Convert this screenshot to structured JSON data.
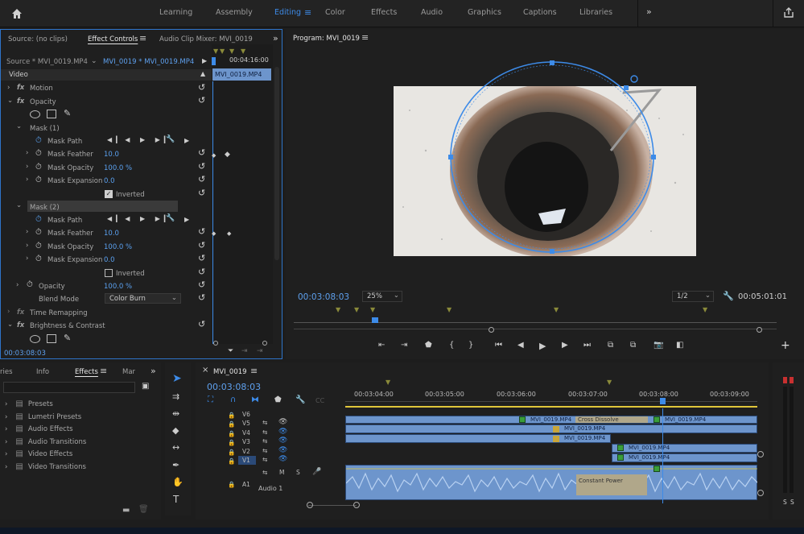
{
  "workspace": {
    "tabs": [
      "Learning",
      "Assembly",
      "Editing",
      "Color",
      "Effects",
      "Audio",
      "Graphics",
      "Captions",
      "Libraries"
    ],
    "active": "Editing",
    "more_icon": "chevron-double-right-icon"
  },
  "effect_panel": {
    "tabs": [
      "Source: (no clips)",
      "Effect Controls",
      "Audio Clip Mixer: MVI_0019"
    ],
    "source_label": "Source * MVI_0019.MP4",
    "clip_label": "MVI_0019 * MVI_0019.MP4",
    "timecode_ruler": "00:04:16:00",
    "clip_bar": "MVI_0019.MP4",
    "section": "Video",
    "motion": "Motion",
    "opacity": "Opacity",
    "mask1": {
      "name": "Mask (1)",
      "path": "Mask Path",
      "feather_label": "Mask Feather",
      "feather": "10.0",
      "opacity_label": "Mask Opacity",
      "opacity": "100.0 %",
      "expansion_label": "Mask Expansion",
      "expansion": "0.0",
      "inverted": "Inverted",
      "inverted_checked": true
    },
    "mask2": {
      "name": "Mask (2)",
      "path": "Mask Path",
      "feather_label": "Mask Feather",
      "feather": "10.0",
      "opacity_label": "Mask Opacity",
      "opacity": "100.0 %",
      "expansion_label": "Mask Expansion",
      "expansion": "0.0",
      "inverted": "Inverted",
      "inverted_checked": false
    },
    "opacity_label": "Opacity",
    "opacity_value": "100.0 %",
    "blend_label": "Blend Mode",
    "blend_value": "Color Burn",
    "time_remap": "Time Remapping",
    "brightness": "Brightness & Contrast",
    "timecode": "00:03:08:03"
  },
  "program": {
    "title": "Program: MVI_0019",
    "timecode": "00:03:08:03",
    "zoom": "25%",
    "resolution": "1/2",
    "duration": "00:05:01:01"
  },
  "effects_panel": {
    "tabs": [
      "ries",
      "Info",
      "Effects",
      "Mar"
    ],
    "items": [
      "Presets",
      "Lumetri Presets",
      "Audio Effects",
      "Audio Transitions",
      "Video Effects",
      "Video Transitions"
    ]
  },
  "timeline": {
    "title": "MVI_0019",
    "timecode": "00:03:08:03",
    "ruler": [
      "00:03:04:00",
      "00:03:05:00",
      "00:03:06:00",
      "00:03:07:00",
      "00:03:08:00",
      "00:03:09:00"
    ],
    "tracks": [
      "V6",
      "V5",
      "V4",
      "V3",
      "V2",
      "V1",
      "A1"
    ],
    "audio_name": "Audio 1",
    "clips": {
      "v5": "MVI_0019.MP4",
      "v5b": "MVI_0019.MP4",
      "v5_trans": "Cross Dissolve",
      "v4": "MVI_0019.MP4",
      "v3": "MVI_0019.MP4",
      "v2": "MVI_0019.MP4",
      "v1": "MVI_0019.MP4",
      "a_trans": "Constant Power"
    },
    "audio_buttons": [
      "M",
      "S"
    ],
    "meter_labels": [
      "S",
      "S"
    ]
  }
}
